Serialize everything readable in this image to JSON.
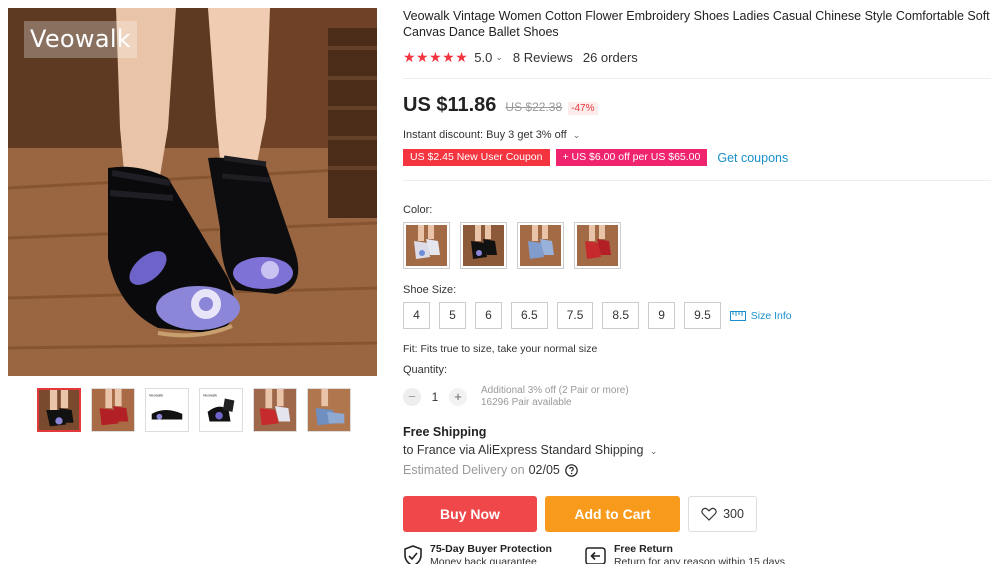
{
  "gallery": {
    "brand_watermark": "Veowalk",
    "thumbnails": [
      "thumb-1",
      "thumb-2",
      "thumb-3",
      "thumb-4",
      "thumb-5",
      "thumb-6"
    ],
    "thumbnail_labels": {
      "t3": "Veowalk",
      "t4": "Veowalk"
    }
  },
  "product": {
    "title": "Veowalk Vintage Women Cotton Flower Embroidery Shoes Ladies Casual Chinese Style Comfortable Soft Canvas Dance Ballet Shoes",
    "rating": {
      "stars": 5,
      "value": "5.0",
      "reviews": "8 Reviews",
      "orders": "26 orders"
    },
    "price": {
      "current": "US $11.86",
      "original": "US $22.38",
      "discount": "-47%"
    },
    "instant_discount": "Instant discount: Buy 3 get 3% off",
    "coupons": [
      "US $2.45 New User Coupon",
      "+ US $6.00 off per US $65.00"
    ],
    "get_coupons": "Get coupons",
    "color_label": "Color:",
    "colors": [
      "white-blue",
      "black",
      "blue",
      "red"
    ],
    "size_label": "Shoe Size:",
    "sizes": [
      "4",
      "5",
      "6",
      "6.5",
      "7.5",
      "8.5",
      "9",
      "9.5"
    ],
    "size_info": "Size Info",
    "fit": "Fit: Fits true to size, take your normal size",
    "quantity_label": "Quantity:",
    "quantity": "1",
    "qty_note_1": "Additional 3% off (2 Pair or more)",
    "qty_note_2": "16296 Pair available",
    "shipping_title": "Free Shipping",
    "shipping_dest": "to France via AliExpress Standard Shipping",
    "delivery_prefix": "Estimated Delivery on",
    "delivery_date": "02/05",
    "buy_now": "Buy Now",
    "add_to_cart": "Add to Cart",
    "wishlist_count": "300",
    "protection_title": "75-Day Buyer Protection",
    "protection_sub": "Money back guarantee",
    "return_title": "Free Return",
    "return_sub": "Return for any reason within 15 days"
  },
  "colors": {
    "accent_red": "#f0474a",
    "accent_orange": "#f89a1c",
    "star": "#f4343f",
    "link": "#1a8fcb"
  }
}
